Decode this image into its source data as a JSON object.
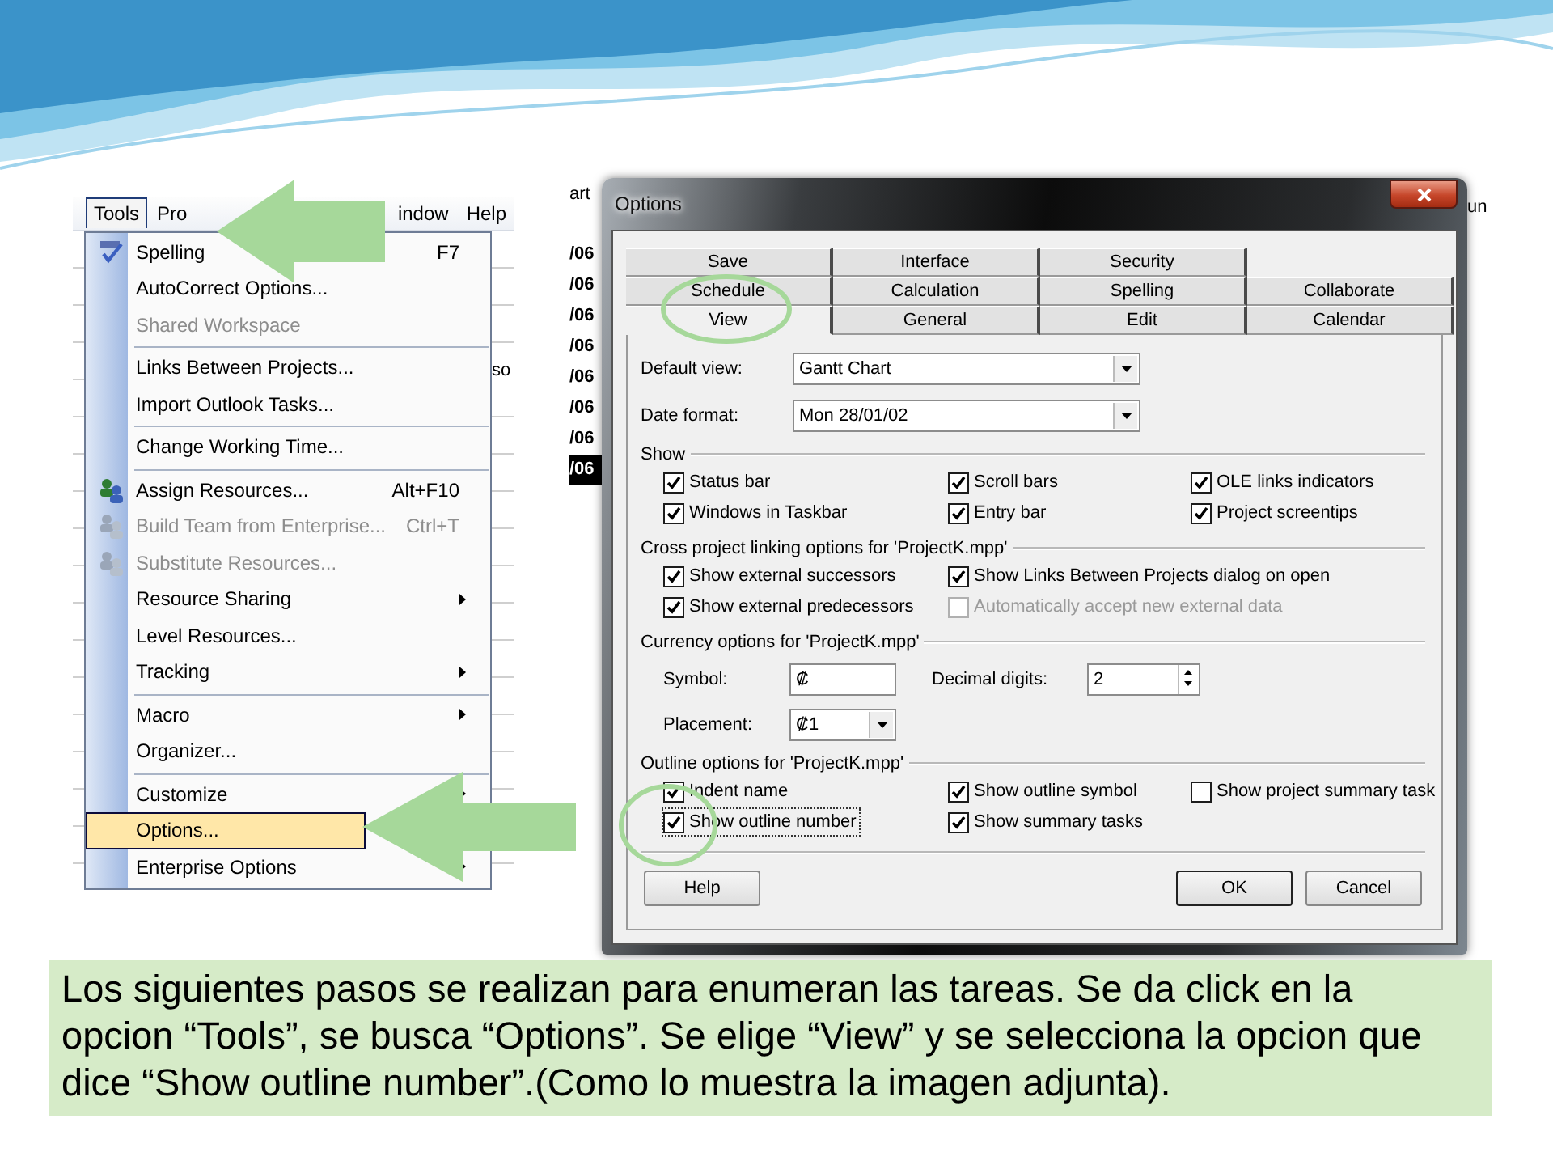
{
  "menu_screenshot": {
    "menubar": [
      {
        "label": "Tools",
        "selected": true
      },
      {
        "label": "Pro",
        "selected": false
      },
      {
        "label": "indow",
        "selected": false
      },
      {
        "label": "Help",
        "selected": false
      }
    ],
    "side_text": "so",
    "items": [
      {
        "label": "Spelling",
        "shortcut": "F7",
        "has_icon": true,
        "disabled": false,
        "submenu": false,
        "selected": false,
        "separator_before": false
      },
      {
        "label": "AutoCorrect Options...",
        "has_icon": false,
        "disabled": false,
        "submenu": false,
        "selected": false,
        "separator_before": false
      },
      {
        "label": "Shared Workspace",
        "has_icon": false,
        "disabled": true,
        "submenu": false,
        "selected": false,
        "separator_before": false
      },
      {
        "label": "Links Between Projects...",
        "has_icon": false,
        "disabled": false,
        "submenu": false,
        "selected": false,
        "separator_before": true
      },
      {
        "label": "Import Outlook Tasks...",
        "has_icon": false,
        "disabled": false,
        "submenu": false,
        "selected": false,
        "separator_before": false
      },
      {
        "label": "Change Working Time...",
        "has_icon": false,
        "disabled": false,
        "submenu": false,
        "selected": false,
        "separator_before": true
      },
      {
        "label": "Assign Resources...",
        "shortcut": "Alt+F10",
        "has_icon": true,
        "disabled": false,
        "submenu": false,
        "selected": false,
        "separator_before": true
      },
      {
        "label": "Build Team from Enterprise...",
        "shortcut": "Ctrl+T",
        "has_icon": true,
        "disabled": true,
        "submenu": false,
        "selected": false,
        "separator_before": false
      },
      {
        "label": "Substitute Resources...",
        "has_icon": true,
        "disabled": true,
        "submenu": false,
        "selected": false,
        "separator_before": false
      },
      {
        "label": "Resource Sharing",
        "has_icon": false,
        "disabled": false,
        "submenu": true,
        "selected": false,
        "separator_before": false
      },
      {
        "label": "Level Resources...",
        "has_icon": false,
        "disabled": false,
        "submenu": false,
        "selected": false,
        "separator_before": false
      },
      {
        "label": "Tracking",
        "has_icon": false,
        "disabled": false,
        "submenu": true,
        "selected": false,
        "separator_before": false
      },
      {
        "label": "Macro",
        "has_icon": false,
        "disabled": false,
        "submenu": true,
        "selected": false,
        "separator_before": true
      },
      {
        "label": "Organizer...",
        "has_icon": false,
        "disabled": false,
        "submenu": false,
        "selected": false,
        "separator_before": false
      },
      {
        "label": "Customize",
        "has_icon": false,
        "disabled": false,
        "submenu": true,
        "selected": false,
        "separator_before": true
      },
      {
        "label": "Options...",
        "has_icon": false,
        "disabled": false,
        "submenu": false,
        "selected": true,
        "separator_before": false
      },
      {
        "label": "Enterprise Options",
        "has_icon": false,
        "disabled": false,
        "submenu": true,
        "selected": false,
        "separator_before": false
      }
    ]
  },
  "dialog_screenshot": {
    "background": {
      "header": "art",
      "rows": [
        {
          "text": "/06",
          "selected": false
        },
        {
          "text": "/06",
          "selected": false
        },
        {
          "text": "/06",
          "selected": false
        },
        {
          "text": "/06",
          "selected": false
        },
        {
          "text": "/06",
          "selected": false
        },
        {
          "text": "/06",
          "selected": false
        },
        {
          "text": "/06",
          "selected": false
        },
        {
          "text": "/06",
          "selected": true
        }
      ],
      "edge": "un"
    },
    "window": {
      "title": "Options"
    },
    "tab_rows": [
      [
        {
          "label": "Save",
          "selected": false
        },
        {
          "label": "Interface",
          "selected": false
        },
        {
          "label": "Security",
          "selected": false
        }
      ],
      [
        {
          "label": "Schedule",
          "selected": false
        },
        {
          "label": "Calculation",
          "selected": false
        },
        {
          "label": "Spelling",
          "selected": false
        },
        {
          "label": "Collaborate",
          "selected": false
        }
      ],
      [
        {
          "label": "View",
          "selected": true
        },
        {
          "label": "General",
          "selected": false
        },
        {
          "label": "Edit",
          "selected": false
        },
        {
          "label": "Calendar",
          "selected": false
        }
      ]
    ],
    "fields": [
      {
        "label": "Default view:",
        "value": "Gantt Chart"
      },
      {
        "label": "Date format:",
        "value": "Mon 28/01/02"
      }
    ],
    "sections": [
      {
        "title": "Show",
        "checkboxes": [
          {
            "label": "Status bar",
            "checked": true,
            "disabled": false,
            "focused": false
          },
          {
            "label": "Scroll bars",
            "checked": true,
            "disabled": false,
            "focused": false
          },
          {
            "label": "OLE links indicators",
            "checked": true,
            "disabled": false,
            "focused": false
          },
          {
            "label": "Windows in Taskbar",
            "checked": true,
            "disabled": false,
            "focused": false
          },
          {
            "label": "Entry bar",
            "checked": true,
            "disabled": false,
            "focused": false
          },
          {
            "label": "Project screentips",
            "checked": true,
            "disabled": false,
            "focused": false
          }
        ]
      },
      {
        "title": "Cross project linking options for 'ProjectK.mpp'",
        "checkboxes": [
          {
            "label": "Show external successors",
            "checked": true,
            "disabled": false,
            "focused": false
          },
          {
            "label": "Show Links Between Projects dialog on open",
            "checked": true,
            "disabled": false,
            "focused": false
          },
          {
            "label": "Show external predecessors",
            "checked": true,
            "disabled": false,
            "focused": false
          },
          {
            "label": "Automatically accept new external data",
            "checked": false,
            "disabled": true,
            "focused": false
          }
        ]
      },
      {
        "title": "Currency options for 'ProjectK.mpp'",
        "symbol": {
          "label": "Symbol:",
          "value": "₡"
        },
        "decimal_digits": {
          "label": "Decimal digits:",
          "value": "2"
        },
        "placement": {
          "label": "Placement:",
          "value": "₡1"
        }
      },
      {
        "title": "Outline options for 'ProjectK.mpp'",
        "checkboxes": [
          {
            "label": "Indent name",
            "checked": true,
            "disabled": false,
            "focused": false
          },
          {
            "label": "Show outline symbol",
            "checked": true,
            "disabled": false,
            "focused": false
          },
          {
            "label": "Show project summary task",
            "checked": false,
            "disabled": false,
            "focused": false
          },
          {
            "label": "Show outline number",
            "checked": true,
            "disabled": false,
            "focused": true
          },
          {
            "label": "Show summary tasks",
            "checked": true,
            "disabled": false,
            "focused": false
          }
        ]
      }
    ],
    "buttons": [
      {
        "label": "Help",
        "default": false
      },
      {
        "label": "OK",
        "default": true
      },
      {
        "label": "Cancel",
        "default": false
      }
    ]
  },
  "caption": "Los siguientes pasos se realizan para enumeran las tareas. Se da click en la opcion “Tools”, se busca “Options”. Se elige “View” y se selecciona la opcion que dice “Show outline number”.(Como lo muestra la imagen adjunta)."
}
